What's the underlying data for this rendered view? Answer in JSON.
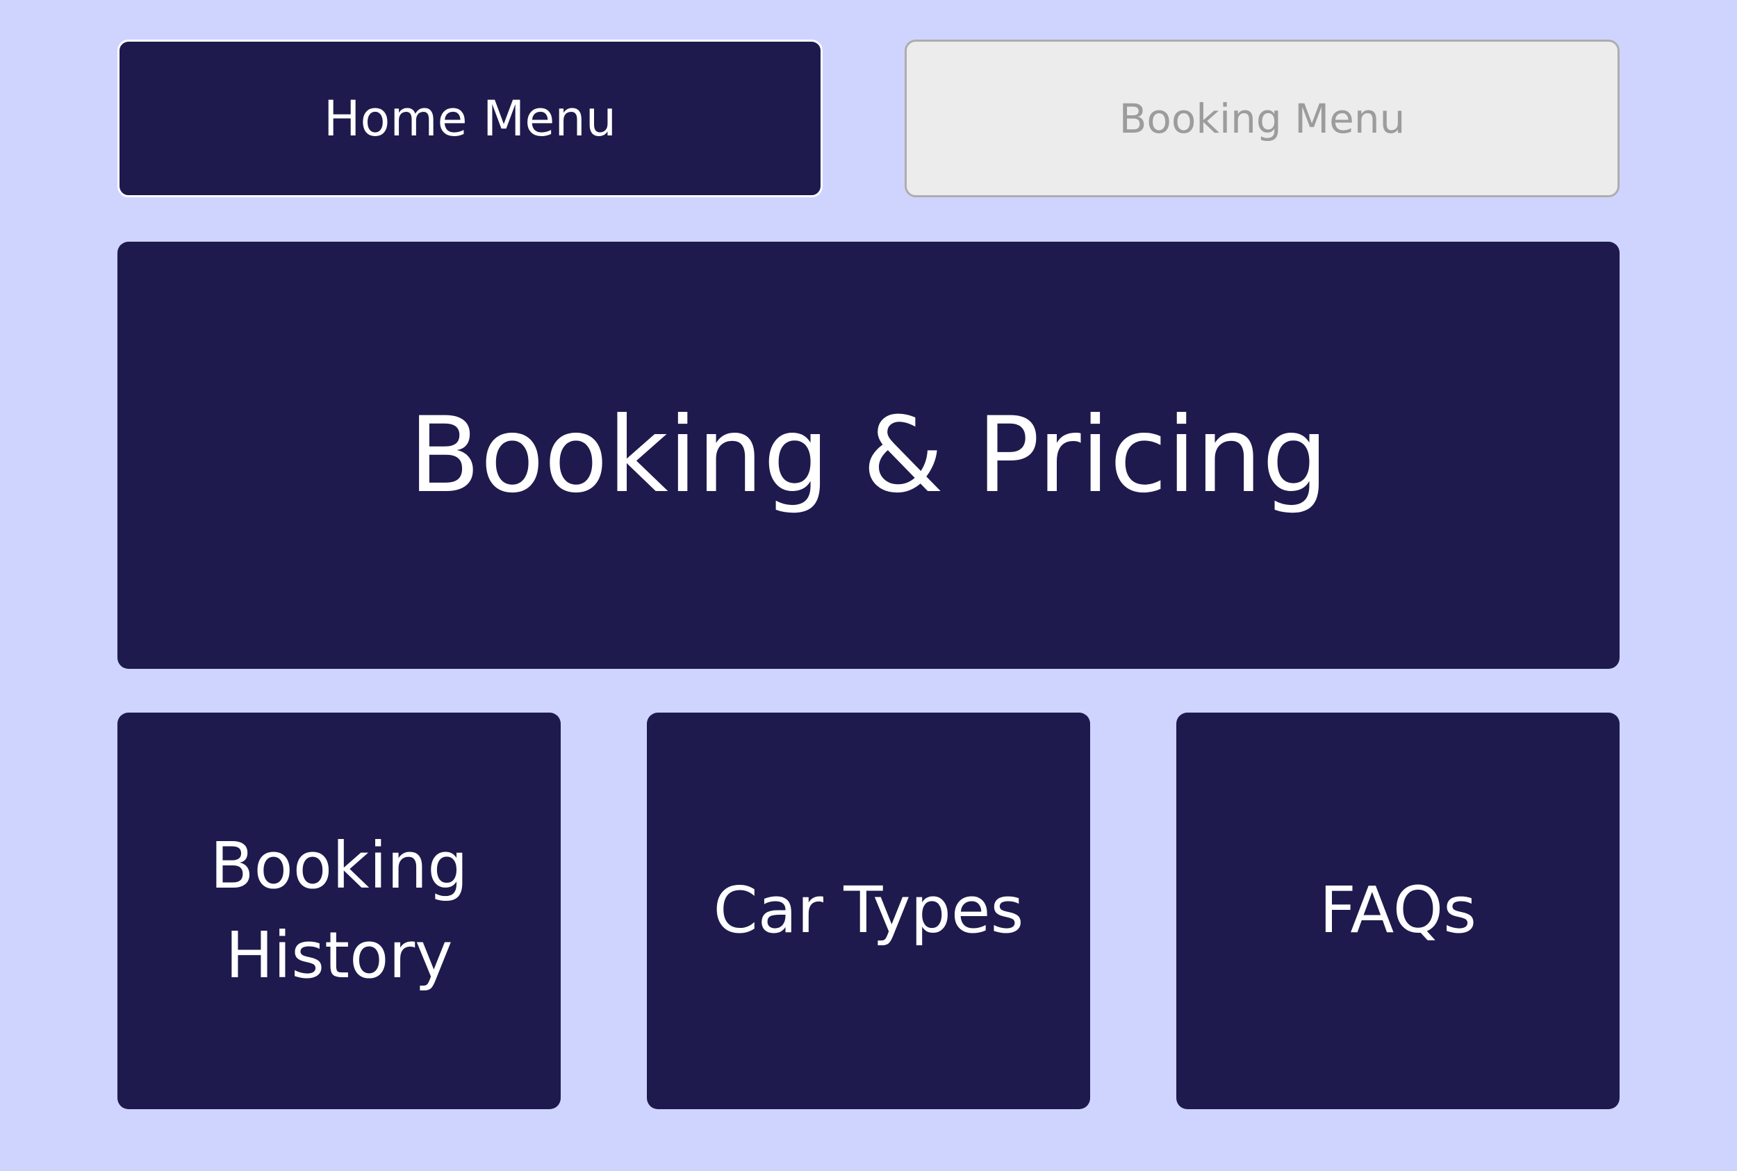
{
  "nav": {
    "home_label": "Home Menu",
    "booking_label": "Booking Menu"
  },
  "hero": {
    "title": "Booking & Pricing"
  },
  "cards": {
    "history_line1": "Booking",
    "history_line2": "History",
    "car_types": "Car Types",
    "faqs": "FAQs"
  },
  "colors": {
    "page_background": "#cfd4ff",
    "tile_background": "#1e1a4d",
    "tile_text": "#ffffff",
    "disabled_background": "#ececec",
    "disabled_text": "#9c9c9c"
  }
}
